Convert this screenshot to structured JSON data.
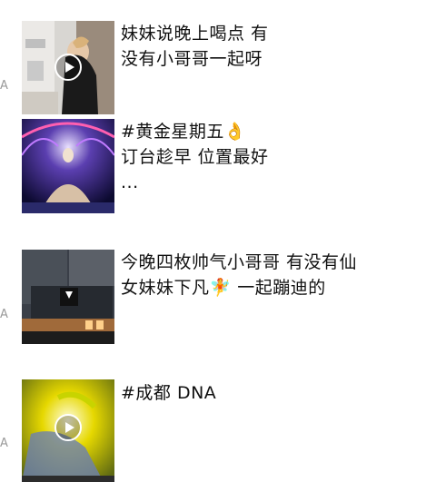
{
  "feed": {
    "posts": [
      {
        "side_letter": "A",
        "lines": [
          "妹妹说晚上喝点 有",
          "没有小哥哥一起呀"
        ],
        "has_play_icon": true,
        "thumb_icon": "video-thumbnail-icon"
      },
      {
        "side_letter": "",
        "lines": [
          "#黄金星期五👌",
          "订台趁早  位置最好",
          "..."
        ],
        "has_play_icon": false,
        "thumb_icon": "image-thumbnail-icon"
      },
      {
        "side_letter": "A",
        "lines": [
          "今晚四枚帅气小哥哥  有没有仙",
          "女妹妹下凡🧚 一起蹦迪的"
        ],
        "has_play_icon": false,
        "thumb_icon": "image-thumbnail-icon"
      },
      {
        "side_letter": "A",
        "lines": [
          "#成都 DNA"
        ],
        "has_play_icon": true,
        "thumb_icon": "video-thumbnail-icon"
      }
    ]
  },
  "colors": {
    "text": "#111111",
    "side_letter": "#9a9a9a",
    "background": "#ffffff"
  }
}
